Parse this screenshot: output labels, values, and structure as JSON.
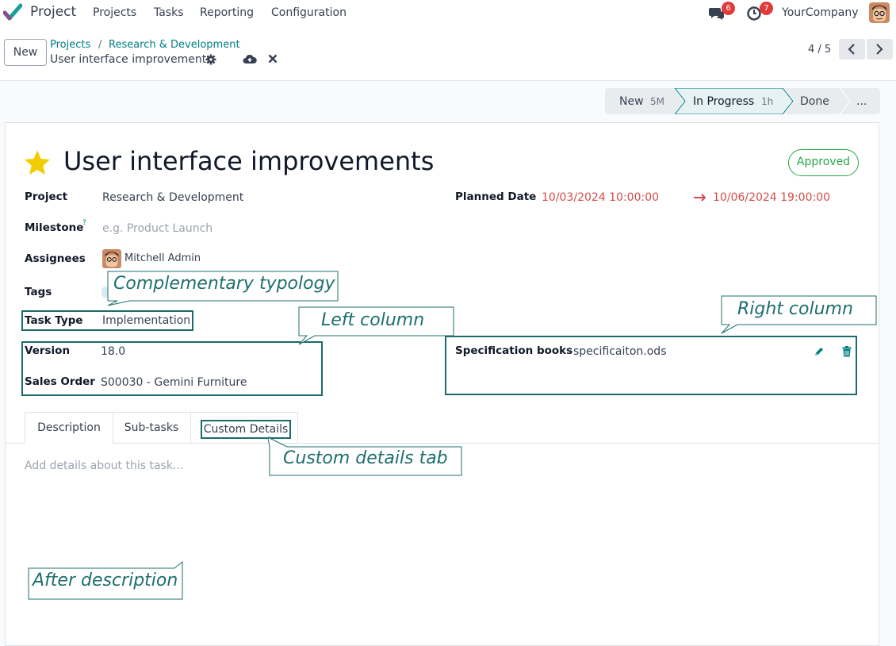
{
  "nav": {
    "app_name": "Project",
    "menu": [
      "Projects",
      "Tasks",
      "Reporting",
      "Configuration"
    ],
    "messages_count": "6",
    "activities_count": "7",
    "company": "YourCompany"
  },
  "control": {
    "new_label": "New",
    "breadcrumb": [
      "Projects",
      "Research & Development"
    ],
    "breadcrumb_sep": "/",
    "current": "User interface improvements",
    "pager": "4 / 5"
  },
  "stages": [
    {
      "name": "New",
      "duration": "5M",
      "active": false
    },
    {
      "name": "In Progress",
      "duration": "1h",
      "active": true
    },
    {
      "name": "Done",
      "duration": "",
      "active": false
    },
    {
      "name": "...",
      "duration": "",
      "active": false
    }
  ],
  "task": {
    "title": "User interface improvements",
    "status": "Approved",
    "project_label": "Project",
    "project": "Research & Development",
    "planned_label": "Planned Date",
    "planned_start": "10/03/2024 10:00:00",
    "planned_end": "10/06/2024 19:00:00",
    "milestone_label": "Milestone",
    "milestone_help": "?",
    "milestone_placeholder": "e.g. Product Launch",
    "assignees_label": "Assignees",
    "assignee": "Mitchell Admin",
    "tags_label": "Tags",
    "task_type_label": "Task Type",
    "task_type": "Implementation",
    "version_label": "Version",
    "version": "18.0",
    "sales_order_label": "Sales Order",
    "sales_order": "S00030 - Gemini Furniture",
    "spec_label": "Specification books",
    "spec_file": "specificaiton.ods"
  },
  "tabs": [
    "Description",
    "Sub-tasks",
    "Custom Details"
  ],
  "description_placeholder": "Add details about this task...",
  "callouts": {
    "complementary": "Complementary typology",
    "left": "Left column",
    "right": "Right column",
    "custom_tab": "Custom details tab",
    "after": "After description"
  },
  "colors": {
    "accent": "#017e84",
    "annotation": "#1d6f6e",
    "badge": "#e33b3b",
    "approved": "#28a745",
    "date_red": "#d44c4c",
    "star": "#f3cc00"
  }
}
